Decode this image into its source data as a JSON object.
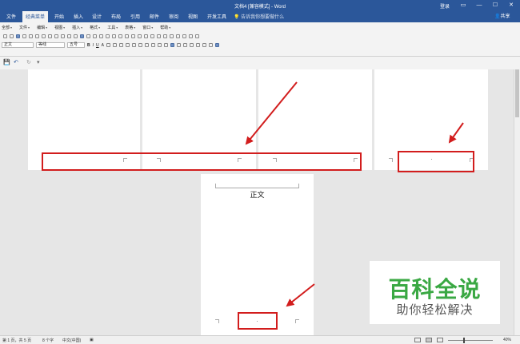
{
  "window": {
    "title": "文档4 [兼容模式] - Word",
    "login": "登录",
    "controls": [
      "▭",
      "—",
      "☐",
      "✕"
    ]
  },
  "tabs": [
    "文件",
    "经典菜单",
    "开始",
    "插入",
    "设计",
    "布局",
    "引用",
    "邮件",
    "审阅",
    "视图",
    "开发工具"
  ],
  "active_tab": "经典菜单",
  "tell_me": "告诉我你想要做什么",
  "share": "共享",
  "classic_menu": [
    "全部",
    "文件",
    "编辑",
    "视图",
    "插入",
    "格式",
    "工具",
    "表格",
    "窗口",
    "帮助"
  ],
  "format_bar": {
    "style": "正文",
    "font": "等线",
    "size": "五号",
    "bold": "B",
    "italic": "I",
    "underline": "U",
    "highlight": "A"
  },
  "document": {
    "body_text": "正文"
  },
  "watermark": {
    "title": "百科全说",
    "subtitle": "助你轻松解决"
  },
  "statusbar": {
    "page": "第 1 页，共 5 页",
    "words": "8 个字",
    "language": "中文(中国)",
    "zoom": "40%"
  }
}
